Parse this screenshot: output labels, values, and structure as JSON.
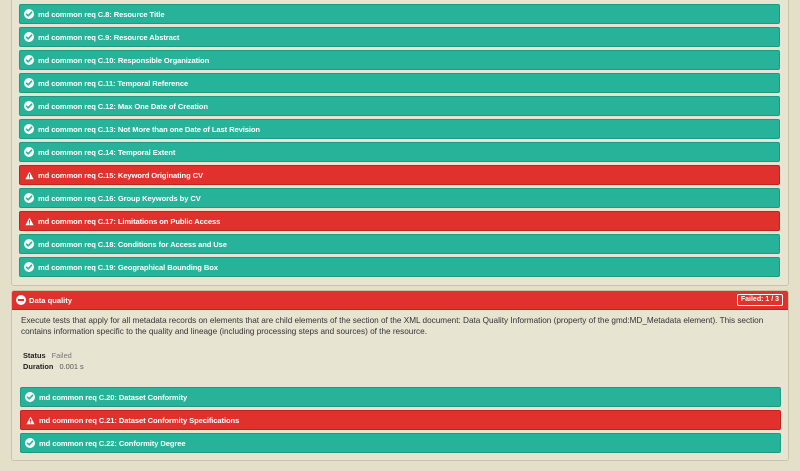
{
  "top_tests": [
    {
      "label": "md common req C.8: Resource Title",
      "status": "pass"
    },
    {
      "label": "md common req C.9: Resource Abstract",
      "status": "pass"
    },
    {
      "label": "md common req C.10: Responsible Organization",
      "status": "pass"
    },
    {
      "label": "md common req C.11: Temporal Reference",
      "status": "pass"
    },
    {
      "label": "md common req C.12: Max One Date of Creation",
      "status": "pass"
    },
    {
      "label": "md common req C.13: Not More than one Date of Last Revision",
      "status": "pass"
    },
    {
      "label": "md common req C.14: Temporal Extent",
      "status": "pass"
    },
    {
      "label": "md common req C.15: Keyword Originating CV",
      "status": "fail"
    },
    {
      "label": "md common req C.16: Group Keywords by CV",
      "status": "pass"
    },
    {
      "label": "md common req C.17: Limitations on Public Access",
      "status": "fail"
    },
    {
      "label": "md common req C.18: Conditions for Access and Use",
      "status": "pass"
    },
    {
      "label": "md common req C.19: Geographical Bounding Box",
      "status": "pass"
    }
  ],
  "data_quality": {
    "title": "Data quality",
    "failed_badge": "Failed: 1 / 3",
    "description": "Execute tests that apply for all metadata records on elements that are child elements of the section of the XML document: Data Quality Information (property of the gmd:MD_Metadata element). This section contains information specific to the quality and lineage (including processing steps and sources) of the resource.",
    "status_label": "Status",
    "status_value": "Failed",
    "duration_label": "Duration",
    "duration_value": "0.001 s",
    "tests": [
      {
        "label": "md common req C.20: Dataset Conformity",
        "status": "pass"
      },
      {
        "label": "md common req C.21: Dataset Conformity Specifications",
        "status": "fail"
      },
      {
        "label": "md common req C.22: Conformity Degree",
        "status": "pass"
      }
    ]
  },
  "colors": {
    "pass": "#26b39a",
    "fail": "#e0312c",
    "background": "#e4dfc9"
  },
  "icons": {
    "pass": "check-circle-icon",
    "fail": "warning-triangle-icon",
    "section": "minus-circle-icon"
  }
}
